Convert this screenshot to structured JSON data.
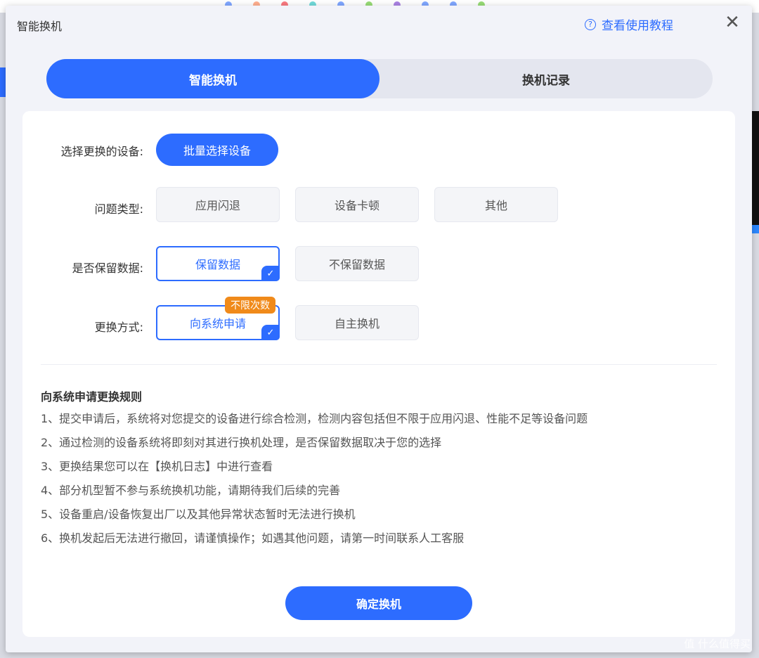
{
  "dialog": {
    "title": "智能换机",
    "help_link": "查看使用教程",
    "close_symbol": "✕"
  },
  "tabs": [
    {
      "label": "智能换机",
      "active": true
    },
    {
      "label": "换机记录",
      "active": false
    }
  ],
  "form": {
    "device": {
      "label": "选择更换的设备:",
      "button": "批量选择设备"
    },
    "problem_type": {
      "label": "问题类型:",
      "options": [
        "应用闪退",
        "设备卡顿",
        "其他"
      ]
    },
    "keep_data": {
      "label": "是否保留数据:",
      "options": [
        "保留数据",
        "不保留数据"
      ],
      "selected": "保留数据"
    },
    "method": {
      "label": "更换方式:",
      "options": [
        "向系统申请",
        "自主换机"
      ],
      "selected": "向系统申请",
      "badge": "不限次数"
    }
  },
  "rules": {
    "title": "向系统申请更换规则",
    "items": [
      "1、提交申请后，系统将对您提交的设备进行综合检测，检测内容包括但不限于应用闪退、性能不足等设备问题",
      "2、通过检测的设备系统将即刻对其进行换机处理，是否保留数据取决于您的选择",
      "3、更换结果您可以在【换机日志】中进行查看",
      "4、部分机型暂不参与系统换机功能，请期待我们后续的完善",
      "5、设备重启/设备恢复出厂以及其他异常状态暂时无法进行换机",
      "6、换机发起后无法进行撤回，请谨慎操作；如遇其他问题，请第一时间联系人工客服"
    ]
  },
  "confirm_button": "确定换机",
  "watermark": "值 什么值得买",
  "colors": {
    "accent": "#2d6cff",
    "badge": "#f08a1a",
    "dialog_bg": "#f2f3f9",
    "panel_bg": "#ffffff"
  }
}
